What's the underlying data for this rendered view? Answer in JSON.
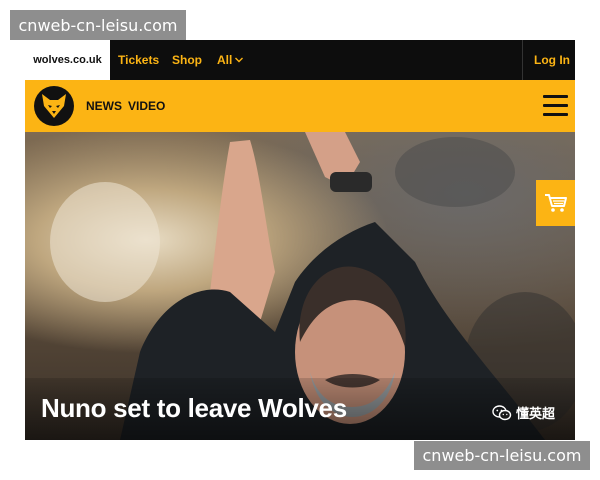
{
  "watermark": {
    "top": "cnweb-cn-leisu.com",
    "bottom": "cnweb-cn-leisu.com"
  },
  "topbar": {
    "site": "wolves.co.uk",
    "links": [
      "Tickets",
      "Shop",
      "All"
    ],
    "login": "Log In"
  },
  "nav": {
    "items": [
      "NEWS",
      "VIDEO"
    ]
  },
  "hero": {
    "headline": "Nuno set to leave Wolves",
    "account_label": "懂英超"
  },
  "colors": {
    "brand_orange": "#fcb414",
    "dark": "#0d0d0d"
  },
  "icons": [
    "wolf-logo-icon",
    "hamburger-menu-icon",
    "shopping-cart-icon",
    "chevron-down-icon",
    "wechat-icon"
  ]
}
